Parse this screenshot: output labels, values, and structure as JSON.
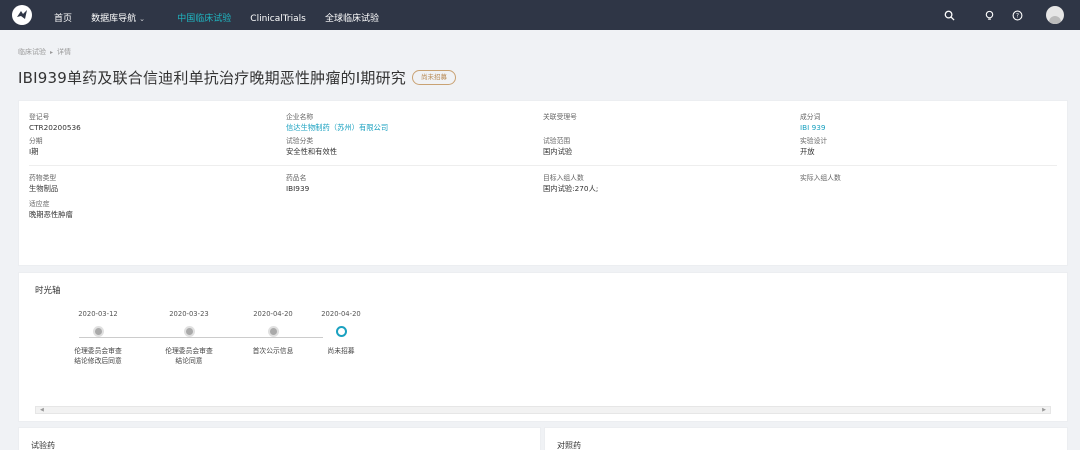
{
  "nav": {
    "home": "首页",
    "db_nav": "数据库导航",
    "china_trials": "中国临床试验",
    "clinical_trials": "ClinicalTrials",
    "global_trials": "全球临床试验"
  },
  "breadcrumb": {
    "root": "临床试验",
    "sep": "▸",
    "current": "详情"
  },
  "page": {
    "title": "IBI939单药及联合信迪利单抗治疗晚期恶性肿瘤的I期研究",
    "status": "尚未招募"
  },
  "info": {
    "row1": [
      {
        "label": "登记号",
        "value": "CTR20200536"
      },
      {
        "label": "企业名称",
        "value": "信达生物制药（苏州）有限公司"
      },
      {
        "label": "关联受理号",
        "value": ""
      },
      {
        "label": "成分词",
        "value": "IBI 939"
      }
    ],
    "row2": [
      {
        "label": "分期",
        "value": "I期"
      },
      {
        "label": "试验分类",
        "value": "安全性和有效性"
      },
      {
        "label": "试验范围",
        "value": "国内试验"
      },
      {
        "label": "实验设计",
        "value": "开放"
      }
    ],
    "row3": [
      {
        "label": "药物类型",
        "value": "生物制品"
      },
      {
        "label": "药品名",
        "value": "IBI939"
      },
      {
        "label": "目标入组人数",
        "value": "国内试验:270人;"
      },
      {
        "label": "实际入组人数",
        "value": ""
      }
    ],
    "indication": {
      "label": "适应症",
      "value": "晚期恶性肿瘤"
    }
  },
  "timeline": {
    "title": "时光轴",
    "items": [
      {
        "date": "2020-03-12",
        "label1": "伦理委员会审查",
        "label2": "结论修改后同意"
      },
      {
        "date": "2020-03-23",
        "label1": "伦理委员会审查",
        "label2": "结论同意"
      },
      {
        "date": "2020-04-20",
        "label1": "首次公示信息",
        "label2": ""
      },
      {
        "date": "2020-04-20",
        "label1": "尚未招募",
        "label2": ""
      }
    ]
  },
  "bottom": {
    "test_drug": "试验药",
    "control_drug": "对照药"
  },
  "colors": {
    "topbar": "#2f3646",
    "accent": "#1aa1c0",
    "status": "#b88a55"
  },
  "icons": [
    "logo-icon",
    "chevron-down-icon",
    "search-icon",
    "bulb-icon",
    "help-icon",
    "avatar"
  ]
}
